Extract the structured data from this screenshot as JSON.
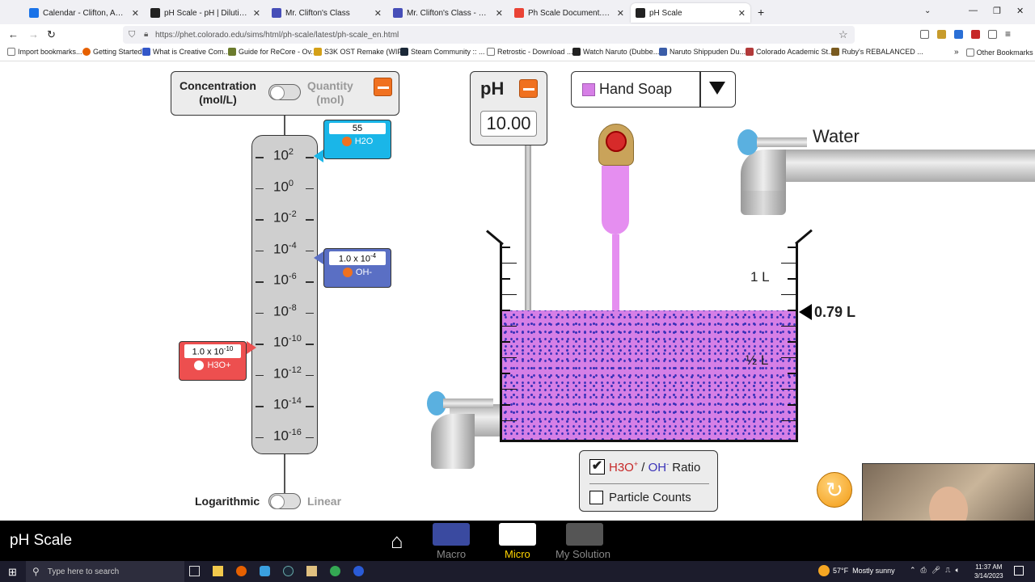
{
  "browser": {
    "tabs": [
      {
        "title": "Calendar - Clifton, Adrian - Out",
        "color": "#1a73e8"
      },
      {
        "title": "pH Scale - pH | Dilution | Conc",
        "color": "#222"
      },
      {
        "title": "Mr. Clifton's Class",
        "color": "#464eb8"
      },
      {
        "title": "Mr. Clifton's Class - Screencast",
        "color": "#464eb8"
      },
      {
        "title": "Ph Scale Document.pdf - Goog",
        "color": "#ea4335"
      },
      {
        "title": "pH Scale",
        "color": "#222"
      }
    ],
    "url": "https://phet.colorado.edu/sims/html/ph-scale/latest/ph-scale_en.html",
    "bookmarks": [
      "Import bookmarks...",
      "Getting Started",
      "What is Creative Com...",
      "Guide for ReCore - Ov...",
      "S3K OST Remake (WIP...",
      "Steam Community :: ...",
      "Retrostic - Download ...",
      "Watch Naruto (Dubbe...",
      "Naruto Shippuden Du...",
      "Colorado Academic St...",
      "Ruby's REBALANCED ..."
    ],
    "other_bookmarks": "Other Bookmarks"
  },
  "graph": {
    "mode_left": "Concentration\n(mol/L)",
    "mode_right": "Quantity\n(mol)",
    "ticks": [
      {
        "base": "10",
        "exp": "2"
      },
      {
        "base": "10",
        "exp": "0"
      },
      {
        "base": "10",
        "exp": "-2"
      },
      {
        "base": "10",
        "exp": "-4"
      },
      {
        "base": "10",
        "exp": "-6"
      },
      {
        "base": "10",
        "exp": "-8"
      },
      {
        "base": "10",
        "exp": "-10"
      },
      {
        "base": "10",
        "exp": "-12"
      },
      {
        "base": "10",
        "exp": "-14"
      },
      {
        "base": "10",
        "exp": "-16"
      }
    ],
    "h2o_value": "55",
    "h2o_label": "H2O",
    "oh_value": "1.0 x 10",
    "oh_exp": "-4",
    "oh_label": "OH-",
    "h3o_value": "1.0 x 10",
    "h3o_exp": "-10",
    "h3o_label": "H3O+",
    "scale_left": "Logarithmic",
    "scale_right": "Linear"
  },
  "ph_meter": {
    "label": "pH",
    "value": "10.00"
  },
  "solute": {
    "name": "Hand Soap",
    "color": "#d67fe6"
  },
  "beaker": {
    "volume": "0.79 L",
    "mark_1l": "1 L",
    "mark_half": "½ L",
    "water_label": "Water"
  },
  "options": {
    "ratio_label_h3o": "H3O",
    "ratio_sep": " / ",
    "ratio_label_oh": "OH",
    "ratio_suffix": " Ratio",
    "ratio_checked": true,
    "counts_label": "Particle Counts",
    "counts_checked": false
  },
  "nav": {
    "title": "pH Scale",
    "screens": [
      "Macro",
      "Micro",
      "My Solution"
    ],
    "active": "Micro"
  },
  "taskbar": {
    "search_placeholder": "Type here to search",
    "weather": "57°F  Mostly sunny",
    "time": "11:37 AM",
    "date": "3/14/2023"
  }
}
